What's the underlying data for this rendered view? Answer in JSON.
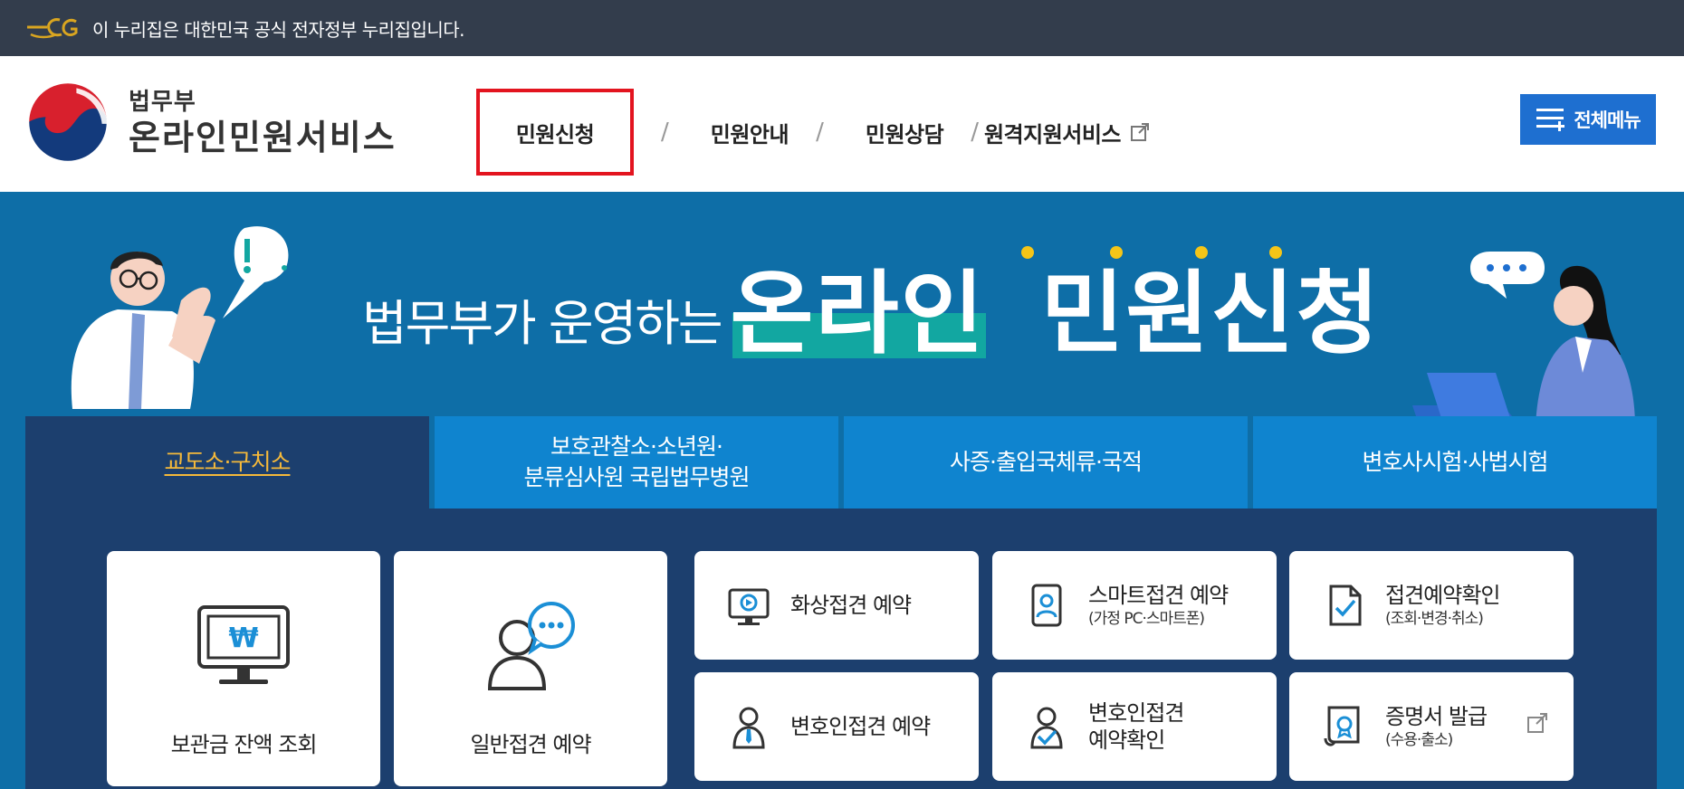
{
  "gov_banner": {
    "logo_text": "eG",
    "text": "이 누리집은 대한민국 공식 전자정부 누리집입니다."
  },
  "header": {
    "logo": {
      "ministry": "법무부",
      "service": "온라인민원서비스"
    },
    "nav": [
      {
        "label": "민원신청",
        "selected": true
      },
      {
        "label": "민원안내"
      },
      {
        "label": "민원상담"
      },
      {
        "label": "원격지원서비스",
        "external": true
      }
    ],
    "separator": "/",
    "all_menu_label": "전체메뉴"
  },
  "hero": {
    "title_small": "법무부가 운영하는",
    "title_highlight": "온라인",
    "title_rest": "민원신청"
  },
  "tabs": [
    {
      "line1": "교도소·구치소",
      "line2": "",
      "active": true
    },
    {
      "line1": "보호관찰소·소년원·",
      "line2": "분류심사원 국립법무병원"
    },
    {
      "line1": "사증·출입국체류·국적",
      "line2": ""
    },
    {
      "line1": "변호사시험·사법시험",
      "line2": ""
    }
  ],
  "cards": {
    "balance": {
      "label": "보관금 잔액 조회",
      "icon": "monitor-won-icon",
      "symbol": "₩"
    },
    "general_visit": {
      "label": "일반접견 예약",
      "icon": "person-chat-icon"
    },
    "video_visit": {
      "title": "화상접견 예약",
      "sub": "",
      "icon": "video-monitor-icon"
    },
    "smart_visit": {
      "title": "스마트접견 예약",
      "sub": "(가정 PC·스마트폰)",
      "icon": "smartphone-person-icon"
    },
    "visit_check": {
      "title": "접견예약확인",
      "sub": "(조회·변경·취소)",
      "icon": "document-check-icon"
    },
    "lawyer_visit": {
      "title": "변호인접견 예약",
      "sub": "",
      "icon": "lawyer-icon"
    },
    "lawyer_check": {
      "title": "변호인접견",
      "title2": "예약확인",
      "icon": "person-check-icon"
    },
    "certificate": {
      "title": "증명서 발급",
      "sub": "(수용·출소)",
      "icon": "certificate-icon",
      "external": true
    }
  },
  "colors": {
    "banner_bg": "#333d4c",
    "hero_bg": "#0e6ea7",
    "tab_bg": "#0f84cf",
    "panel_bg": "#1c3f6e",
    "active_tab_text": "#f5b93a",
    "highlight": "#12a7a1",
    "menu_button": "#1e6fd0",
    "nav_selected_border": "#e3141f"
  }
}
